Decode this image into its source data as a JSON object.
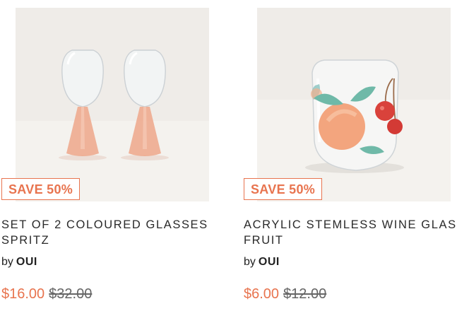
{
  "products": [
    {
      "image": "set of two clear wine glasses with peach coloured stems",
      "badge": "SAVE 50%",
      "title_line1": "SET OF 2 COLOURED GLASSES",
      "title_line2": "SPRITZ",
      "by": "by",
      "brand": "OUI",
      "price_now": "$16.00",
      "price_was": "$32.00"
    },
    {
      "image": "stemless acrylic glass with peach and cherry print",
      "badge": "SAVE 50%",
      "title_line1": "ACRYLIC STEMLESS WINE GLASS",
      "title_line2": "FRUIT",
      "by": "by",
      "brand": "OUI",
      "price_now": "$6.00",
      "price_was": "$12.00"
    }
  ],
  "colors": {
    "accent": "#e8744f",
    "image_bg": "#eeebe6"
  }
}
